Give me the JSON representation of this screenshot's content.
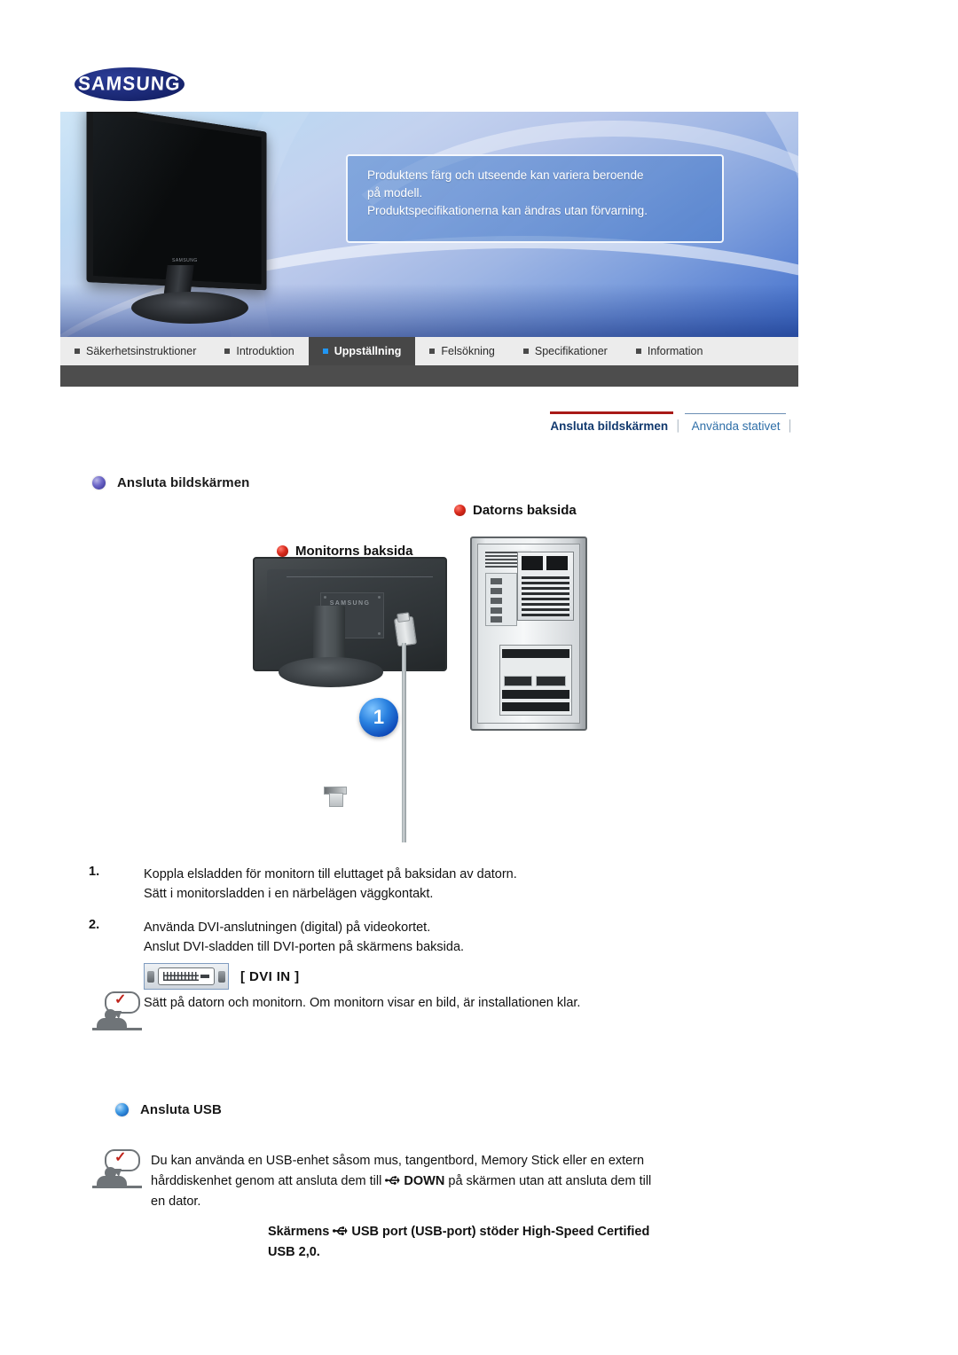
{
  "brand": {
    "logo_text": "SAMSUNG"
  },
  "hero": {
    "notice_lines": [
      "Produktens färg och utseende kan variera beroende",
      "på modell.",
      "Produktspecifikationerna kan ändras utan förvarning."
    ],
    "product_logo": "SAMSUNG"
  },
  "tabs": [
    {
      "label": "Säkerhetsinstruktioner",
      "active": false
    },
    {
      "label": "Introduktion",
      "active": false
    },
    {
      "label": "Uppställning",
      "active": true
    },
    {
      "label": "Felsökning",
      "active": false
    },
    {
      "label": "Specifikationer",
      "active": false
    },
    {
      "label": "Information",
      "active": false
    }
  ],
  "subnav": {
    "items": [
      {
        "label": "Ansluta bildskärmen",
        "active": true
      },
      {
        "label": "Använda stativet",
        "active": false
      }
    ],
    "separator": "│"
  },
  "sections": {
    "connect_display": {
      "title": "Ansluta bildskärmen",
      "bullet_color": "#5b55bd"
    },
    "connect_usb": {
      "title": "Ansluta USB",
      "bullet_color": "#2a82e0"
    }
  },
  "diagram": {
    "monitor_label": "Monitorns baksida",
    "pc_label": "Datorns baksida",
    "badge_number": "1",
    "monitor_back_logo": "SAMSUNG",
    "dot_color": "#d92a1c",
    "badge_color": "#0b44b4"
  },
  "steps": [
    {
      "number": "1.",
      "lines": [
        "Koppla elsladden för monitorn till eluttaget på baksidan av datorn.",
        "Sätt i monitorsladden i en närbelägen väggkontakt."
      ]
    },
    {
      "number": "2.",
      "lines": [
        "Använda DVI-anslutningen (digital) på videokortet.",
        "Anslut DVI-sladden till DVI-porten på skärmens baksida."
      ]
    }
  ],
  "dvi": {
    "label": "[ DVI IN ]",
    "icon_name": "dvi-port-icon"
  },
  "note_display": {
    "text": "Sätt på datorn och monitorn. Om monitorn visar en bild, är installationen klar."
  },
  "usb_note": {
    "line1": "Du kan använda en USB-enhet såsom mus, tangentbord, Memory Stick eller en extern",
    "line2_a": "hårddiskenhet genom att ansluta dem till",
    "usb_glyph": "⛔",
    "line2_b": "DOWN",
    "line2_c": "på skärmen utan att ansluta dem till",
    "line3": "en dator."
  },
  "usb_bold": {
    "part_a": "Skärmens",
    "part_b": "USB port (USB-port) stöder High-Speed Certified",
    "part_c": "USB 2,0."
  }
}
